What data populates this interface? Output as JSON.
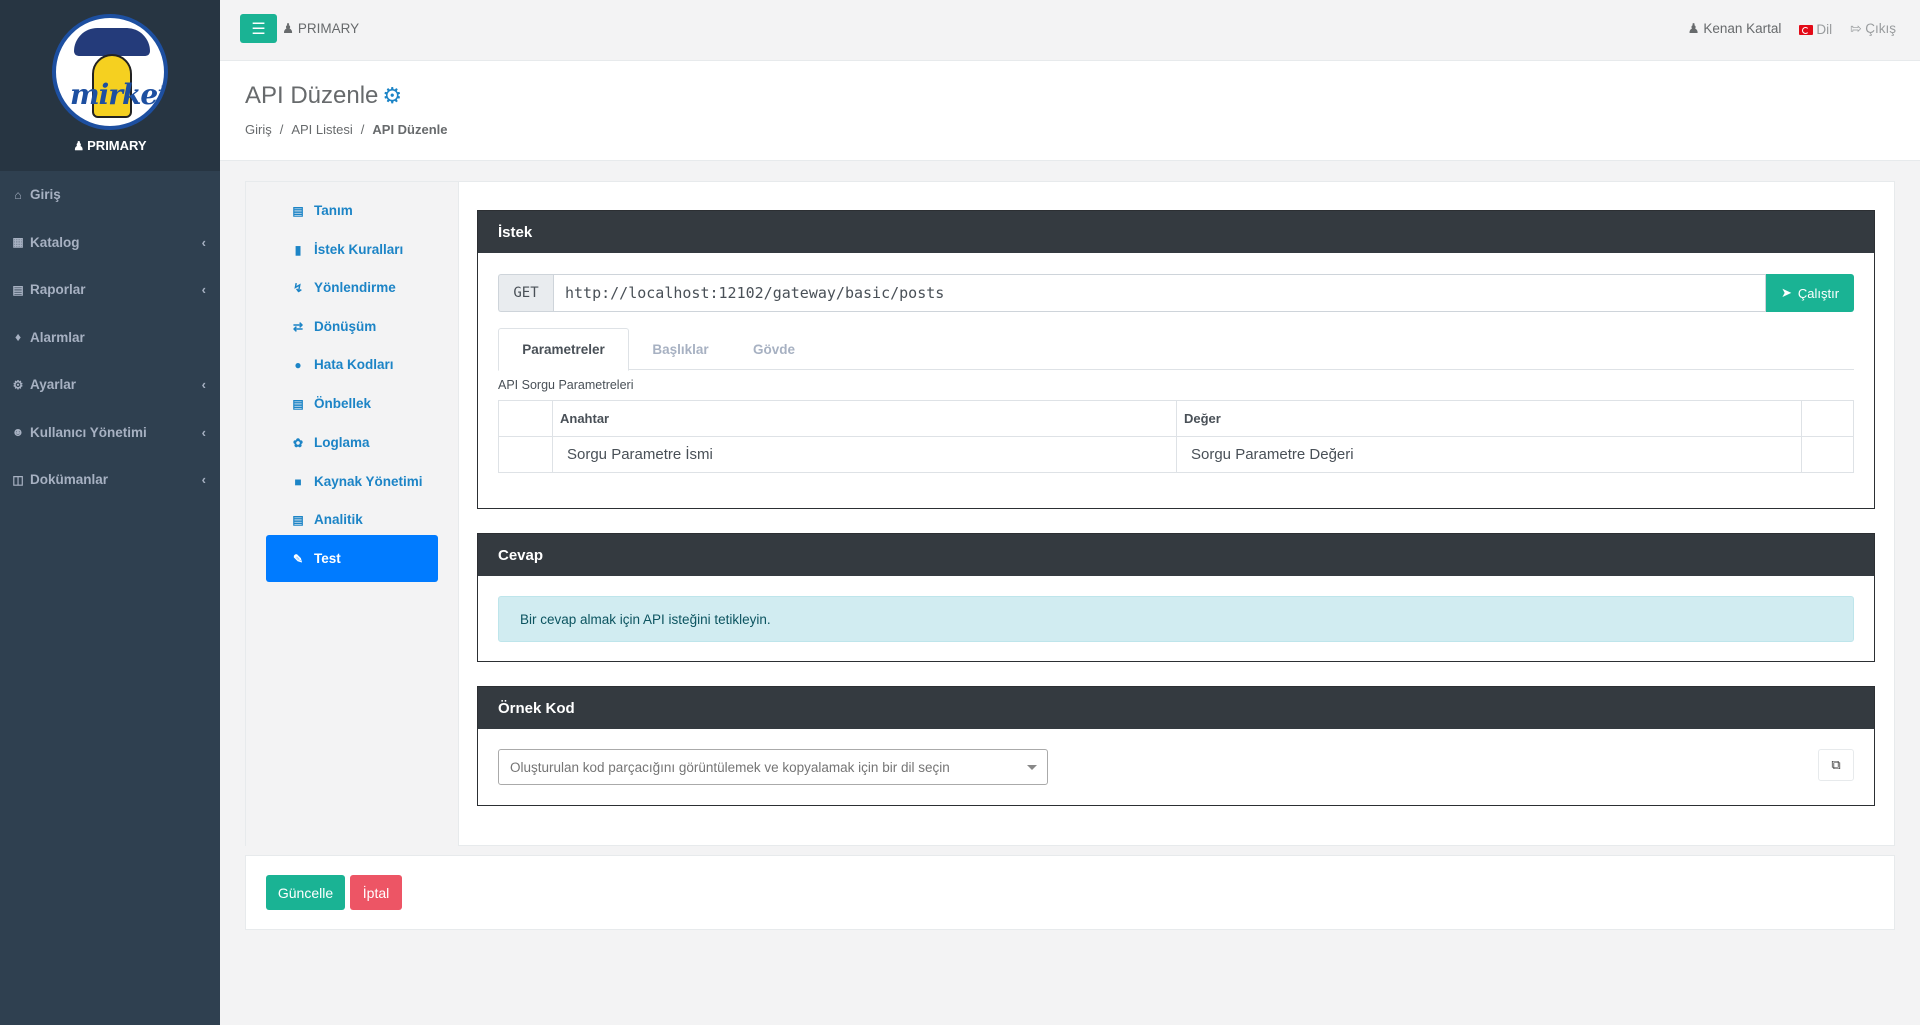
{
  "app": {
    "role_label": "PRIMARY",
    "logo_text": "mirket"
  },
  "topbar": {
    "primary_label": "PRIMARY",
    "user_name": "Kenan Kartal",
    "language_label": "Dil",
    "logout_label": "Çıkış"
  },
  "sidebar": {
    "items": [
      {
        "label": "Giriş",
        "icon": "home-icon",
        "has_submenu": false
      },
      {
        "label": "Katalog",
        "icon": "sitemap-icon",
        "has_submenu": true
      },
      {
        "label": "Raporlar",
        "icon": "chart-icon",
        "has_submenu": true
      },
      {
        "label": "Alarmlar",
        "icon": "bell-icon",
        "has_submenu": false
      },
      {
        "label": "Ayarlar",
        "icon": "cogs-icon",
        "has_submenu": true
      },
      {
        "label": "Kullanıcı Yönetimi",
        "icon": "users-icon",
        "has_submenu": true
      },
      {
        "label": "Dokümanlar",
        "icon": "file-icon",
        "has_submenu": true
      }
    ]
  },
  "page": {
    "title": "API Düzenle",
    "breadcrumb": [
      "Giriş",
      "API Listesi",
      "API Düzenle"
    ]
  },
  "tabs": {
    "items": [
      {
        "label": "Tanım",
        "icon": "id-card-icon"
      },
      {
        "label": "İstek Kuralları",
        "icon": "book-icon"
      },
      {
        "label": "Yönlendirme",
        "icon": "bolt-icon"
      },
      {
        "label": "Dönüşüm",
        "icon": "exchange-icon"
      },
      {
        "label": "Hata Kodları",
        "icon": "exclamation-icon"
      },
      {
        "label": "Önbellek",
        "icon": "memory-icon"
      },
      {
        "label": "Loglama",
        "icon": "feather-icon"
      },
      {
        "label": "Kaynak Yönetimi",
        "icon": "lock-icon"
      },
      {
        "label": "Analitik",
        "icon": "chart-icon"
      },
      {
        "label": "Test",
        "icon": "eyedropper-icon"
      }
    ],
    "active": "Test"
  },
  "request": {
    "title": "İstek",
    "method": "GET",
    "url": "http://localhost:12102/gateway/basic/posts",
    "run_label": "Çalıştır",
    "subtabs": [
      "Parametreler",
      "Başlıklar",
      "Gövde"
    ],
    "active_subtab": "Parametreler",
    "params_label": "API Sorgu Parametreleri",
    "columns": [
      "Anahtar",
      "Değer"
    ],
    "key_placeholder": "Sorgu Parametre İsmi",
    "value_placeholder": "Sorgu Parametre Değeri"
  },
  "response": {
    "title": "Cevap",
    "message": "Bir cevap almak için API isteğini tetikleyin."
  },
  "sample_code": {
    "title": "Örnek Kod",
    "select_placeholder": "Oluşturulan kod parçacığını görüntülemek ve kopyalamak için bir dil seçin"
  },
  "actions": {
    "update_label": "Güncelle",
    "cancel_label": "İptal"
  },
  "colors": {
    "primary": "#1ab394",
    "danger": "#ed5565",
    "sidebar": "#2f4050",
    "active_tab": "#007bff",
    "link": "#1c84c6"
  }
}
